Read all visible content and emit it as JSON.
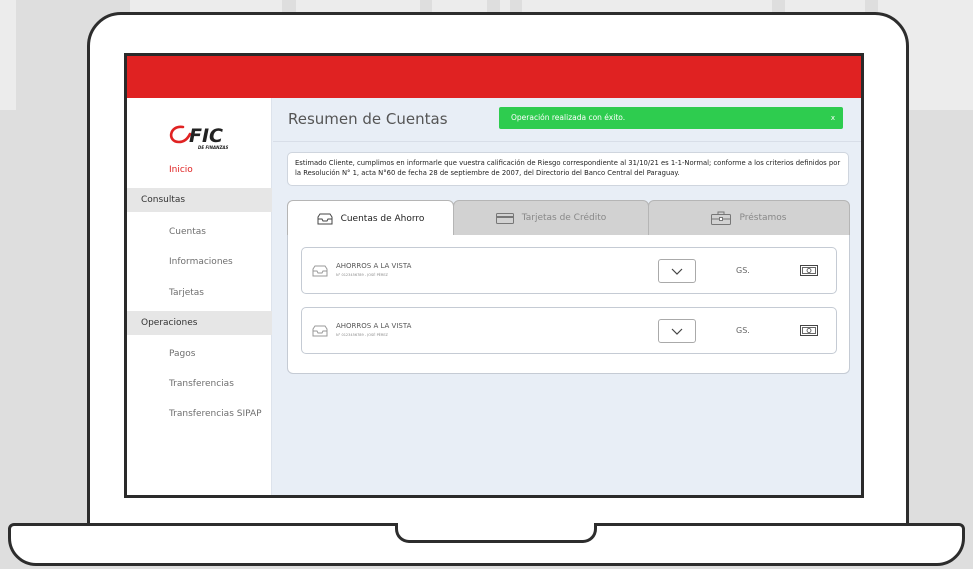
{
  "app": {
    "logo_text": "FIC",
    "logo_subtext": "DE FINANZAS",
    "brand_color": "#e02222"
  },
  "sidebar": {
    "home": "Inicio",
    "sections": [
      {
        "label": "Consultas",
        "items": [
          "Cuentas",
          "Informaciones",
          "Tarjetas"
        ]
      },
      {
        "label": "Operaciones",
        "items": [
          "Pagos",
          "Transferencias",
          "Transferencias SIPAP"
        ]
      }
    ]
  },
  "header": {
    "title": "Resumen de Cuentas",
    "toast": "Operación realizada con éxito.",
    "toast_close": "x",
    "toast_color": "#2ecc4f"
  },
  "notice": {
    "text": "Estimado Cliente, cumplimos en informarle que vuestra calificación de Riesgo correspondiente al 31/10/21 es 1-1-Normal; conforme a los criterios definidos por la Resolución N° 1, acta N°60 de fecha 28 de septiembre de 2007, del Directorio del Banco Central del Paraguay."
  },
  "tabs": [
    {
      "label": "Cuentas de Ahorro",
      "icon": "wallet-icon",
      "active": true
    },
    {
      "label": "Tarjetas de Crédito",
      "icon": "credit-card-icon",
      "active": false
    },
    {
      "label": "Préstamos",
      "icon": "briefcase-icon",
      "active": false
    }
  ],
  "accounts": [
    {
      "name": "AHORROS A LA VISTA",
      "sub": "N° 0123456789 - JOSÉ PÉREZ",
      "currency": "GS."
    },
    {
      "name": "AHORROS A LA VISTA",
      "sub": "N° 0123456789 - JOSÉ PÉREZ",
      "currency": "GS."
    }
  ]
}
